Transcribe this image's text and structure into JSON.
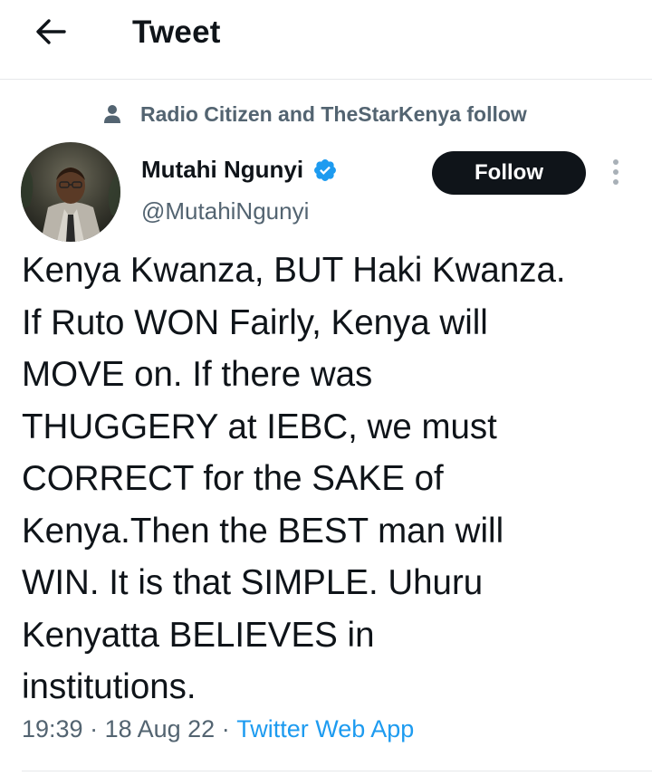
{
  "header": {
    "title": "Tweet",
    "back_icon": "arrow-left-icon"
  },
  "social_context": {
    "icon": "person-icon",
    "text": "Radio Citizen and TheStarKenya follow"
  },
  "author": {
    "display_name": "Mutahi Ngunyi",
    "handle": "@MutahiNgunyi",
    "verified": true,
    "verified_color": "#1d9bf0"
  },
  "actions": {
    "follow_label": "Follow",
    "more_icon": "more-vertical-icon"
  },
  "tweet": {
    "text": "Kenya Kwanza, BUT Haki Kwanza.\nIf Ruto WON Fairly, Kenya will\nMOVE on. If there was\nTHUGGERY at IEBC, we must\nCORRECT for the SAKE of\nKenya.Then the BEST man will\nWIN. It is that SIMPLE. Uhuru\nKenyatta BELIEVES in\ninstitutions.",
    "time": "19:39",
    "separator": " · ",
    "date": "18 Aug 22",
    "source": "Twitter Web App"
  },
  "colors": {
    "text_primary": "#0f1419",
    "text_secondary": "#536471",
    "link": "#1d9bf0",
    "follow_bg": "#0f1419"
  }
}
